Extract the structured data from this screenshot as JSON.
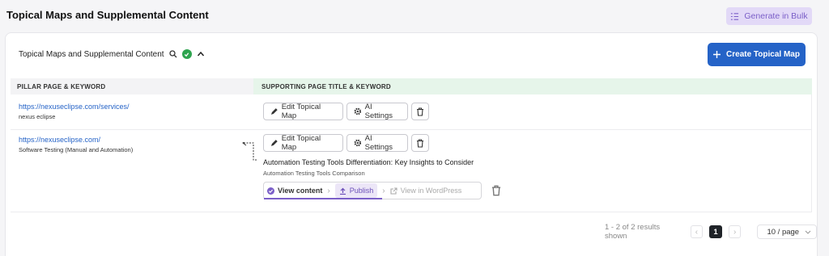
{
  "page": {
    "title": "Topical Maps and Supplemental Content",
    "generate_bulk_label": "Generate in Bulk"
  },
  "card": {
    "header_title": "Topical Maps and Supplemental Content",
    "create_label": "Create Topical Map"
  },
  "table": {
    "columns": [
      "PILLAR PAGE & KEYWORD",
      "SUPPORTING PAGE TITLE & KEYWORD"
    ],
    "rows": [
      {
        "pillar_url": "https://nexuseclipse.com/services/",
        "pillar_keyword": "nexus eclipse",
        "edit_label": "Edit Topical Map",
        "ai_label": "AI Settings"
      },
      {
        "pillar_url": "https://nexuseclipse.com/",
        "pillar_keyword": "Software Testing (Manual and Automation)",
        "edit_label": "Edit Topical Map",
        "ai_label": "AI Settings",
        "supporting_title": "Automation Testing Tools Differentiation: Key Insights to Consider",
        "supporting_keyword": "Automation Testing Tools Comparison",
        "flow": {
          "view_content": "View content",
          "publish": "Publish",
          "view_wordpress": "View in WordPress"
        }
      }
    ]
  },
  "pagination": {
    "summary": "1 - 2 of 2 results shown",
    "current_page": "1",
    "per_page": "10 / page"
  },
  "colors": {
    "primary": "#2563c7",
    "accent": "#7b5fc8",
    "success": "#2ea44f"
  }
}
